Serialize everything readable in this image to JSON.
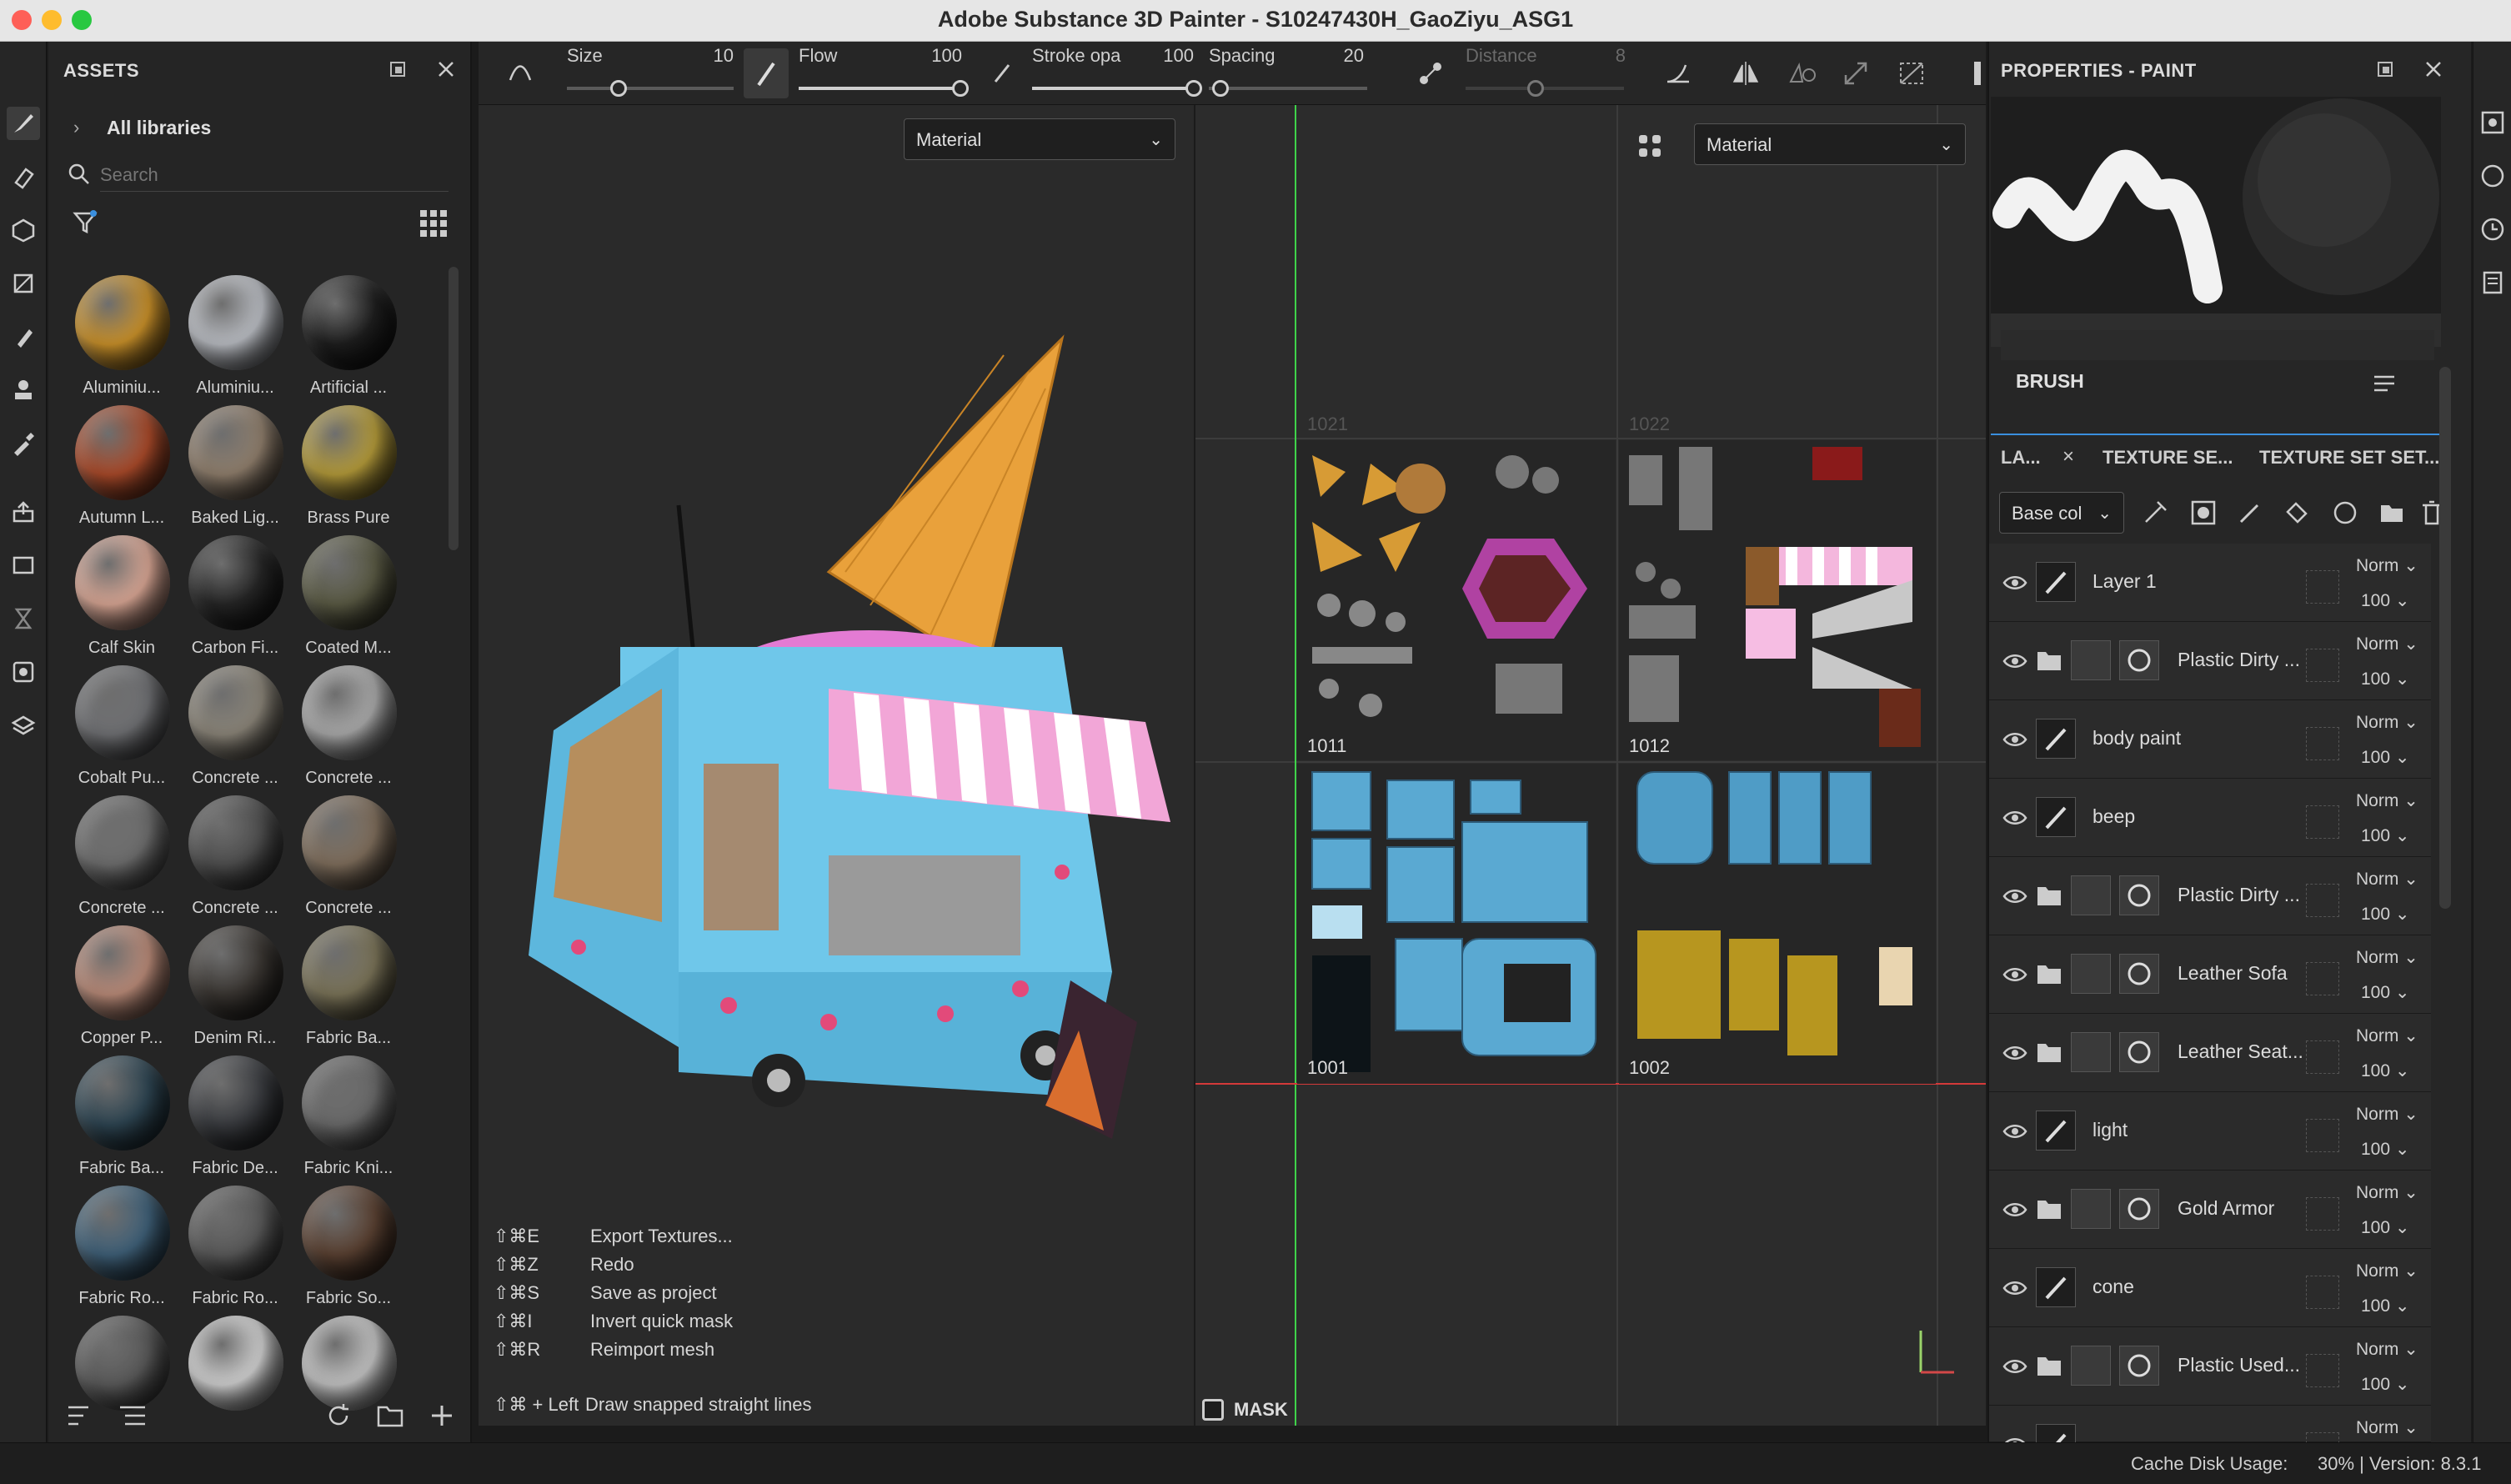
{
  "window": {
    "title": "Adobe Substance 3D Painter - S10247430H_GaoZiyu_ASG1"
  },
  "assets": {
    "title": "ASSETS",
    "all_libraries": "All libraries",
    "search_placeholder": "Search",
    "materials": [
      {
        "label": "Aluminiu...",
        "color": "#c8902a"
      },
      {
        "label": "Aluminiu...",
        "color": "#b9bcc2"
      },
      {
        "label": "Artificial ...",
        "color": "#1e1e1e"
      },
      {
        "label": "Autumn L...",
        "color": "#a94a2a"
      },
      {
        "label": "Baked Lig...",
        "color": "#8f7e6c"
      },
      {
        "label": "Brass Pure",
        "color": "#b39a3a"
      },
      {
        "label": "Calf Skin",
        "color": "#d7a593"
      },
      {
        "label": "Carbon Fi...",
        "color": "#262626"
      },
      {
        "label": "Coated M...",
        "color": "#5a5a44"
      },
      {
        "label": "Cobalt Pu...",
        "color": "#6f7073"
      },
      {
        "label": "Concrete ...",
        "color": "#8a8478"
      },
      {
        "label": "Concrete ...",
        "color": "#a9a9a9"
      },
      {
        "label": "Concrete ...",
        "color": "#6e6e6e"
      },
      {
        "label": "Concrete ...",
        "color": "#4f4f4f"
      },
      {
        "label": "Concrete ...",
        "color": "#7f6e5c"
      },
      {
        "label": "Copper P...",
        "color": "#b98a78"
      },
      {
        "label": "Denim Ri...",
        "color": "#3a3632"
      },
      {
        "label": "Fabric Ba...",
        "color": "#7a7358"
      },
      {
        "label": "Fabric Ba...",
        "color": "#2e4552"
      },
      {
        "label": "Fabric De...",
        "color": "#3a3c40"
      },
      {
        "label": "Fabric Kni...",
        "color": "#6a6a6a"
      },
      {
        "label": "Fabric Ro...",
        "color": "#3f6078"
      },
      {
        "label": "Fabric Ro...",
        "color": "#5a5a5a"
      },
      {
        "label": "Fabric So...",
        "color": "#5a4132"
      },
      {
        "label": "",
        "color": "#5a5a5a"
      },
      {
        "label": "",
        "color": "#cfcfcf"
      },
      {
        "label": "",
        "color": "#c2c2c2"
      }
    ]
  },
  "toolbar": {
    "size_label": "Size",
    "size_value": "10",
    "flow_label": "Flow",
    "flow_value": "100",
    "stroke_label": "Stroke opa",
    "stroke_value": "100",
    "spacing_label": "Spacing",
    "spacing_value": "20",
    "distance_label": "Distance",
    "distance_value": "8"
  },
  "viewport3d": {
    "mode": "Material"
  },
  "viewport2d": {
    "mode": "Material",
    "udims": [
      "1021",
      "1022",
      "1011",
      "1012",
      "1001",
      "1002"
    ],
    "mask_label": "MASK"
  },
  "shortcuts": [
    {
      "key": "⇧⌘E",
      "action": "Export Textures..."
    },
    {
      "key": "⇧⌘Z",
      "action": "Redo"
    },
    {
      "key": "⇧⌘S",
      "action": "Save as project"
    },
    {
      "key": "⇧⌘I",
      "action": "Invert quick mask"
    },
    {
      "key": "⇧⌘R",
      "action": "Reimport mesh"
    }
  ],
  "snap_hint": {
    "key": "⇧⌘ + Left",
    "action": "Draw snapped straight lines"
  },
  "properties": {
    "title": "PROPERTIES - PAINT",
    "brush_label": "BRUSH"
  },
  "layers": {
    "tabs": [
      "LA...",
      "TEXTURE SE...",
      "TEXTURE SET SET..."
    ],
    "channel": "Base col",
    "rows": [
      {
        "name": "Layer 1",
        "blend": "Norm",
        "opacity": "100",
        "type": "paint"
      },
      {
        "name": "Plastic Dirty ...",
        "blend": "Norm",
        "opacity": "100",
        "type": "folder"
      },
      {
        "name": "body paint",
        "blend": "Norm",
        "opacity": "100",
        "type": "paint"
      },
      {
        "name": "beep",
        "blend": "Norm",
        "opacity": "100",
        "type": "paint"
      },
      {
        "name": "Plastic Dirty ...",
        "blend": "Norm",
        "opacity": "100",
        "type": "folder"
      },
      {
        "name": "Leather Sofa",
        "blend": "Norm",
        "opacity": "100",
        "type": "folder"
      },
      {
        "name": "Leather Seat...",
        "blend": "Norm",
        "opacity": "100",
        "type": "folder"
      },
      {
        "name": "light",
        "blend": "Norm",
        "opacity": "100",
        "type": "paint"
      },
      {
        "name": "Gold Armor",
        "blend": "Norm",
        "opacity": "100",
        "type": "folder"
      },
      {
        "name": "cone",
        "blend": "Norm",
        "opacity": "100",
        "type": "paint"
      },
      {
        "name": "Plastic Used...",
        "blend": "Norm",
        "opacity": "100",
        "type": "folder"
      },
      {
        "name": "",
        "blend": "Norm",
        "opacity": "",
        "type": "paint"
      }
    ]
  },
  "status": {
    "cache_label": "Cache Disk Usage:",
    "cache_value": "30% | Version: 8.3.1"
  }
}
